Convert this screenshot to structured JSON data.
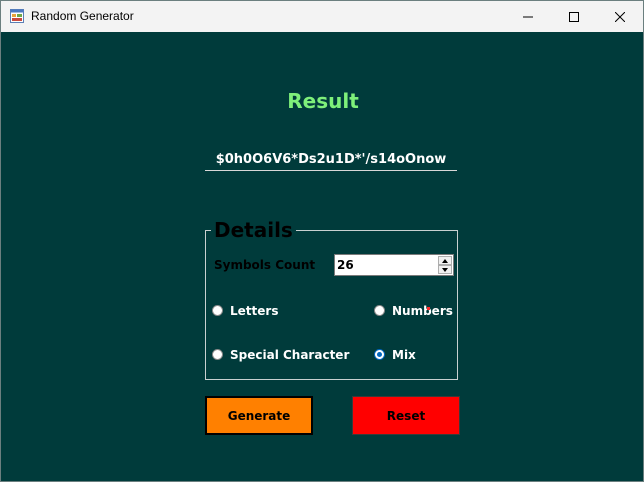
{
  "window": {
    "title": "Random Generator",
    "icon": "app-form-icon"
  },
  "result": {
    "heading": "Result",
    "value": "$0h0O6V6*Ds2u1D*'/s14oOnow",
    "heading_color": "#7ef07a"
  },
  "details": {
    "legend": "Details",
    "symbols_count_label": "Symbols Count",
    "symbols_count_value": "26",
    "options": [
      {
        "label": "Letters",
        "checked": false
      },
      {
        "label": "Numbers",
        "checked": false
      },
      {
        "label": "Special Character",
        "checked": false
      },
      {
        "label": "Mix",
        "checked": true
      }
    ]
  },
  "buttons": {
    "generate_label": "Generate",
    "reset_label": "Reset",
    "generate_color": "#ff8000",
    "reset_color": "#ff0000"
  },
  "colors": {
    "background": "#003b3b",
    "accent": "#0067c0"
  }
}
